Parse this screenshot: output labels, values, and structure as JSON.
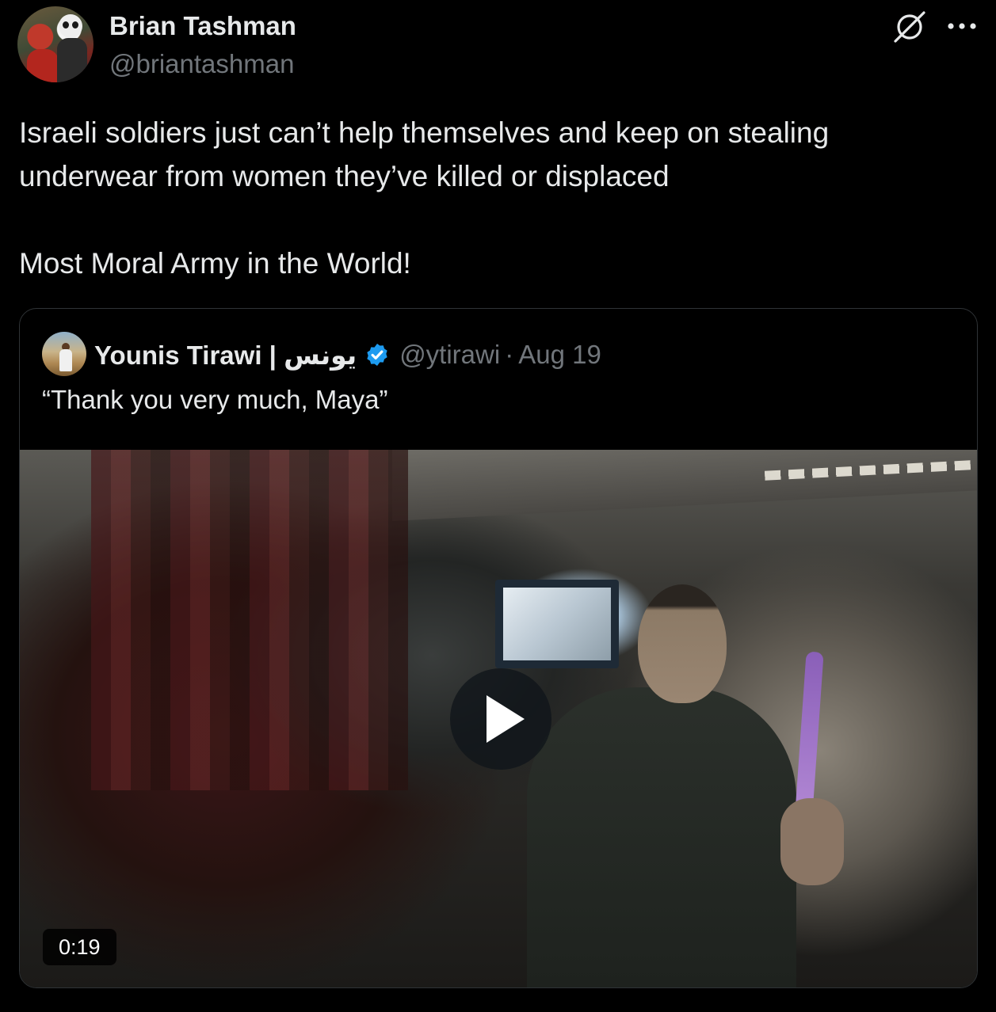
{
  "author": {
    "display_name": "Brian Tashman",
    "handle": "@briantashman",
    "avatar_icon": "user-avatar"
  },
  "actions": {
    "grok_icon": "grok-icon",
    "more_icon": "more-options-icon"
  },
  "tweet": {
    "lines": [
      "Israeli soldiers just can’t help themselves and keep on stealing",
      "underwear from women they’ve killed or displaced",
      "Most Moral Army in the World!"
    ]
  },
  "quoted_tweet": {
    "display_name": "Younis Tirawi | يونس",
    "verified": true,
    "verified_color": "#1d9bf0",
    "handle": "@ytirawi",
    "separator": "·",
    "date": "Aug 19",
    "text": "“Thank you very much, Maya”",
    "video": {
      "duration": "0:19",
      "play_icon": "play-icon"
    }
  },
  "colors": {
    "background": "#000000",
    "primary_text": "#e7e9ea",
    "secondary_text": "#71767b",
    "border": "#2f3336"
  }
}
